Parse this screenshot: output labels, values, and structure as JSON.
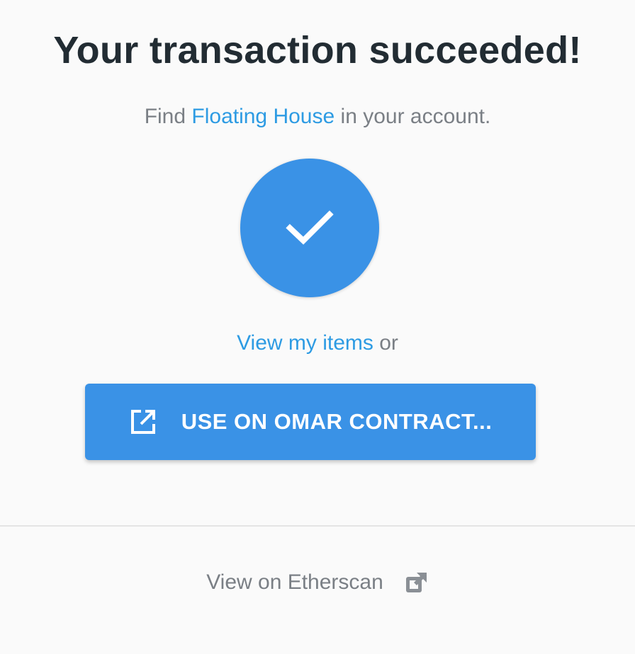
{
  "header": {
    "title": "Your transaction succeeded!"
  },
  "subtitle": {
    "prefix": "Find ",
    "item_link": "Floating House",
    "suffix": " in your account."
  },
  "status": {
    "icon": "checkmark-icon",
    "color": "#3a92e6"
  },
  "items": {
    "link_label": "View my items",
    "connector": " or"
  },
  "cta": {
    "label": "USE ON OMAR CONTRACT...",
    "icon": "external-link-icon",
    "color": "#3a92e6"
  },
  "footer": {
    "etherscan_label": "View on Etherscan",
    "icon": "external-link-icon"
  },
  "colors": {
    "link": "#2d9be3",
    "title": "#222c33",
    "muted": "#7a7f85",
    "background": "#fafafa"
  }
}
